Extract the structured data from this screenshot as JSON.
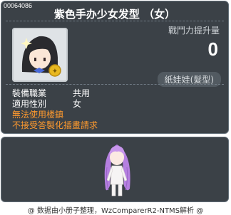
{
  "item": {
    "id": "00064086",
    "name": "紫色手办少女发型 （女）",
    "stat_label": "戰鬥力提升量",
    "stat_value": "0",
    "category": "紙娃娃(髮型)",
    "job_label": "裝備職業",
    "job_value": "共用",
    "gender_label": "適用性別",
    "gender_value": "女",
    "warnings": [
      "無法使用楼鎮",
      "不接受答製化插畫請求"
    ]
  },
  "footer": {
    "credit": "@ 数据由小册子整理，WzComparerR2-NTMS解析 @"
  },
  "colors": {
    "panel_bg": "#3b4147",
    "warning": "#ff9a2e",
    "hair": "#b57fe0"
  },
  "icons": [
    "item-icon",
    "character-preview"
  ]
}
